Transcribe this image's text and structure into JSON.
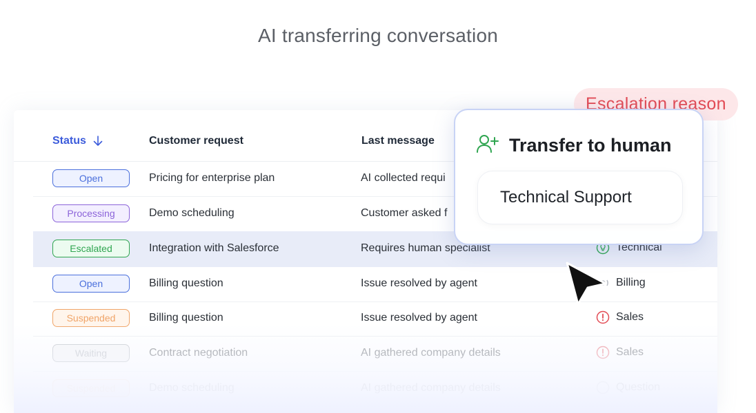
{
  "page": {
    "title": "AI transferring conversation"
  },
  "table": {
    "headers": {
      "status": "Status",
      "request": "Customer request",
      "last": "Last message"
    },
    "rows": [
      {
        "status": "Open",
        "status_color": "#4a6fdc",
        "status_bg": "#eef2ff",
        "request": "Pricing for enterprise plan",
        "last": "AI collected requi",
        "category": "",
        "cat_icon": ""
      },
      {
        "status": "Processing",
        "status_color": "#8b63d9",
        "status_bg": "#f3efff",
        "request": "Demo scheduling",
        "last": "Customer asked f",
        "category": "",
        "cat_icon": ""
      },
      {
        "status": "Escalated",
        "status_color": "#2fa550",
        "status_bg": "#ecfbf0",
        "request": "Integration with Salesforce",
        "last": "Requires human specialist",
        "category": "Technical",
        "cat_icon": "lightbulb-icon"
      },
      {
        "status": "Open",
        "status_color": "#4a6fdc",
        "status_bg": "#eef2ff",
        "request": "Billing question",
        "last": "Issue resolved by agent",
        "category": "Billing",
        "cat_icon": "billing-icon"
      },
      {
        "status": "Suspended",
        "status_color": "#f0a468",
        "status_bg": "#fff5ec",
        "request": "Billing question",
        "last": "Issue resolved by agent",
        "category": "Sales",
        "cat_icon": "alert-icon"
      },
      {
        "status": "Waiting",
        "status_color": "#9aa0a8",
        "status_bg": "#f1f2f4",
        "request": "Contract negotiation",
        "last": "AI gathered company details",
        "category": "Sales",
        "cat_icon": "alert-icon"
      },
      {
        "status": "Suspended",
        "status_color": "#f0a468",
        "status_bg": "#fff5ec",
        "request": "Demo scheduling",
        "last": "AI gathered company details",
        "category": "Question",
        "cat_icon": "question-icon"
      }
    ]
  },
  "popup": {
    "title": "Transfer to human",
    "field_value": "Technical Support",
    "reason_label": "Escalation reason",
    "accent": "#2fa550"
  },
  "colors": {
    "accent": "#3b5bdb",
    "reason": "#e24b55"
  }
}
